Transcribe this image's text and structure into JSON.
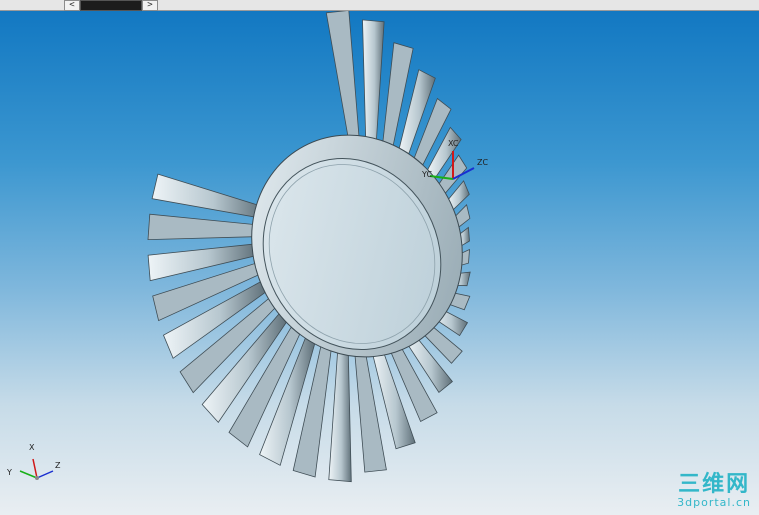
{
  "scrollbar": {
    "left_arrow": "<",
    "right_arrow": ">"
  },
  "csys": {
    "xc": "XC",
    "yc": "YC",
    "zc": "ZC"
  },
  "triad": {
    "x": "X",
    "y": "Y",
    "z": "Z"
  },
  "watermark": {
    "text": "三维网",
    "url": "3dportal.cn"
  },
  "colors": {
    "tooth_light": "#d9e4ea",
    "tooth_dark": "#5a6a72",
    "face": "#c7d8e1",
    "sky_top": "#1278c2"
  }
}
